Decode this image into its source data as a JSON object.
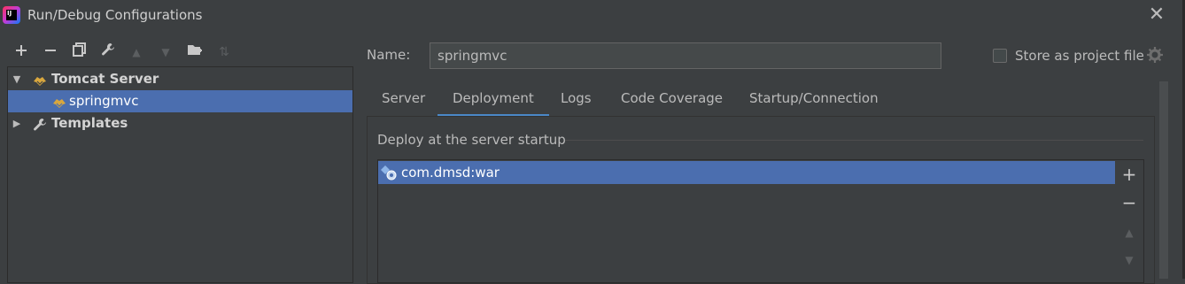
{
  "window": {
    "title": "Run/Debug Configurations"
  },
  "toolbar": {
    "buttons": [
      {
        "icon": "plus",
        "glyph": "+"
      },
      {
        "icon": "minus",
        "glyph": "−"
      },
      {
        "icon": "copy",
        "glyph": "⧉"
      },
      {
        "icon": "wrench",
        "glyph": "🔧"
      },
      {
        "icon": "arrow-up",
        "glyph": "▲"
      },
      {
        "icon": "arrow-down",
        "glyph": "▼"
      },
      {
        "icon": "folder-add",
        "glyph": "📁"
      },
      {
        "icon": "sort",
        "glyph": "⇅"
      }
    ]
  },
  "tree": {
    "items": [
      {
        "label": "Tomcat Server",
        "expanded": true,
        "icon": "tomcat-icon"
      },
      {
        "label": "springmvc",
        "selected": true,
        "icon": "tomcat-icon"
      },
      {
        "label": "Templates",
        "expanded": false,
        "icon": "wrench-icon"
      }
    ]
  },
  "form": {
    "name_label": "Name:",
    "name_value": "springmvc",
    "store_label": "Store as project file",
    "store_checked": false
  },
  "tabs": [
    {
      "label": "Server"
    },
    {
      "label": "Deployment",
      "active": true
    },
    {
      "label": "Logs"
    },
    {
      "label": "Code Coverage"
    },
    {
      "label": "Startup/Connection"
    }
  ],
  "deployment": {
    "section_title": "Deploy at the server startup",
    "artifacts": [
      {
        "label": "com.dmsd:war",
        "selected": true,
        "icon": "artifact-icon"
      }
    ],
    "side_buttons": [
      {
        "icon": "plus",
        "glyph": "+"
      },
      {
        "icon": "minus",
        "glyph": "−"
      },
      {
        "icon": "move-up",
        "glyph": "▲"
      },
      {
        "icon": "move-down",
        "glyph": "▼"
      }
    ]
  }
}
